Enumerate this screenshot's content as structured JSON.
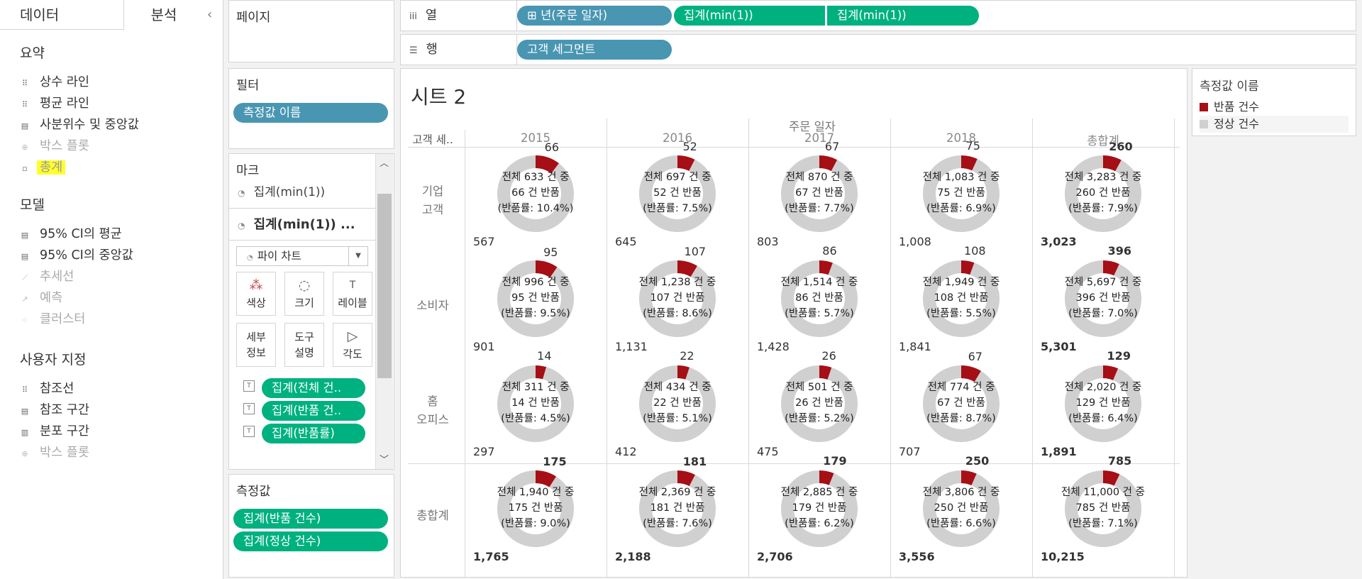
{
  "left": {
    "tabs": [
      "데이터",
      "분석"
    ],
    "collapse_glyph": "‹",
    "sections": [
      {
        "title": "요약",
        "items": [
          {
            "label": "상수 라인",
            "icon": "constant-line-icon",
            "glyph": "⠿",
            "enabled": true
          },
          {
            "label": "평균 라인",
            "icon": "average-line-icon",
            "glyph": "⠿",
            "enabled": true
          },
          {
            "label": "사분위수 및 중앙값",
            "icon": "quartile-icon",
            "glyph": "▤",
            "enabled": true
          },
          {
            "label": "박스 플롯",
            "icon": "box-plot-icon",
            "glyph": "⊕",
            "enabled": false
          },
          {
            "label": "총계",
            "icon": "totals-icon",
            "glyph": "▫",
            "enabled": true,
            "highlighted": true
          }
        ]
      },
      {
        "title": "모델",
        "items": [
          {
            "label": "95% CI의 평균",
            "icon": "ci-average-icon",
            "glyph": "▤",
            "enabled": true
          },
          {
            "label": "95% CI의 중앙값",
            "icon": "ci-median-icon",
            "glyph": "▤",
            "enabled": true
          },
          {
            "label": "추세선",
            "icon": "trend-line-icon",
            "glyph": "⟋",
            "enabled": false
          },
          {
            "label": "예측",
            "icon": "forecast-icon",
            "glyph": "↗",
            "enabled": false
          },
          {
            "label": "클러스터",
            "icon": "cluster-icon",
            "glyph": "⁘",
            "enabled": false
          }
        ]
      },
      {
        "title": "사용자 지정",
        "items": [
          {
            "label": "참조선",
            "icon": "reference-line-icon",
            "glyph": "⠿",
            "enabled": true
          },
          {
            "label": "참조 구간",
            "icon": "reference-band-icon",
            "glyph": "▤",
            "enabled": true
          },
          {
            "label": "분포 구간",
            "icon": "distribution-band-icon",
            "glyph": "▥",
            "enabled": true
          },
          {
            "label": "박스 플롯",
            "icon": "box-plot-icon",
            "glyph": "⊕",
            "enabled": false
          }
        ]
      }
    ]
  },
  "pages": {
    "title": "페이지"
  },
  "filters": {
    "title": "필터",
    "pills": [
      "측정값 이름"
    ]
  },
  "marks": {
    "title": "마크",
    "cards": [
      {
        "label": "집계(min(1))",
        "selected": false
      },
      {
        "label": "집계(min(1)) ...",
        "selected": true
      }
    ],
    "mark_type": "파이 차트",
    "buttons": [
      {
        "label": "색상",
        "icon": "color-icon",
        "glyph": "⁂"
      },
      {
        "label": "크기",
        "icon": "size-icon",
        "glyph": "◌"
      },
      {
        "label": "레이블",
        "icon": "label-icon",
        "glyph": "T"
      },
      {
        "label": "세부\n정보",
        "icon": "detail-icon",
        "glyph": ""
      },
      {
        "label": "도구\n설명",
        "icon": "tooltip-icon",
        "glyph": ""
      },
      {
        "label": "각도",
        "icon": "angle-icon",
        "glyph": "▷"
      }
    ],
    "fields": [
      "집계(전체 건..",
      "집계(반품 건..",
      "집계(반품률)"
    ]
  },
  "measure_values": {
    "title": "측정값",
    "pills": [
      "집계(반품 건수)",
      "집계(정상 건수)"
    ]
  },
  "columns": {
    "label": "열",
    "icon": "iii",
    "pills": [
      "⊞ 년(주문 일자)",
      "집계(min(1))",
      "집계(min(1))"
    ]
  },
  "rows": {
    "label": "행",
    "icon": "☰",
    "pills": [
      "고객 세그먼트"
    ]
  },
  "sheet": {
    "title": "시트 2",
    "col_group_header": "주문 일자",
    "row_header": "고객 세.."
  },
  "legend": {
    "title": "측정값 이름",
    "items": [
      {
        "label": "반품 건수",
        "color": "#a50f15"
      },
      {
        "label": "정상 건수",
        "color": "#d0d0d0"
      }
    ]
  },
  "colors": {
    "returns": "#a50f15",
    "normal": "#d0d0d0",
    "pill_blue": "#4996b2",
    "pill_green": "#00b180"
  },
  "chart_data": {
    "type": "pie",
    "columns": [
      "2015",
      "2016",
      "2017",
      "2018",
      "총합계"
    ],
    "rows": [
      "기업\n고객",
      "소비자",
      "홈\n오피스",
      "총합계"
    ],
    "series": [
      {
        "name": "반품 건수"
      },
      {
        "name": "정상 건수"
      }
    ],
    "cells": [
      [
        {
          "total": "633",
          "returns": 66,
          "normal": 567,
          "normal_label": "567",
          "rate": "10.4%"
        },
        {
          "total": "697",
          "returns": 52,
          "normal": 645,
          "normal_label": "645",
          "rate": "7.5%"
        },
        {
          "total": "870",
          "returns": 67,
          "normal": 803,
          "normal_label": "803",
          "rate": "7.7%"
        },
        {
          "total": "1,083",
          "returns": 75,
          "normal": 1008,
          "normal_label": "1,008",
          "rate": "6.9%"
        },
        {
          "total": "3,283",
          "returns": 260,
          "normal": 3023,
          "normal_label": "3,023",
          "rate": "7.9%"
        }
      ],
      [
        {
          "total": "996",
          "returns": 95,
          "normal": 901,
          "normal_label": "901",
          "rate": "9.5%"
        },
        {
          "total": "1,238",
          "returns": 107,
          "normal": 1131,
          "normal_label": "1,131",
          "rate": "8.6%"
        },
        {
          "total": "1,514",
          "returns": 86,
          "normal": 1428,
          "normal_label": "1,428",
          "rate": "5.7%"
        },
        {
          "total": "1,949",
          "returns": 108,
          "normal": 1841,
          "normal_label": "1,841",
          "rate": "5.5%"
        },
        {
          "total": "5,697",
          "returns": 396,
          "normal": 5301,
          "normal_label": "5,301",
          "rate": "7.0%"
        }
      ],
      [
        {
          "total": "311",
          "returns": 14,
          "normal": 297,
          "normal_label": "297",
          "rate": "4.5%"
        },
        {
          "total": "434",
          "returns": 22,
          "normal": 412,
          "normal_label": "412",
          "rate": "5.1%"
        },
        {
          "total": "501",
          "returns": 26,
          "normal": 475,
          "normal_label": "475",
          "rate": "5.2%"
        },
        {
          "total": "774",
          "returns": 67,
          "normal": 707,
          "normal_label": "707",
          "rate": "8.7%"
        },
        {
          "total": "2,020",
          "returns": 129,
          "normal": 1891,
          "normal_label": "1,891",
          "rate": "6.4%"
        }
      ],
      [
        {
          "total": "1,940",
          "returns": 175,
          "normal": 1765,
          "normal_label": "1,765",
          "rate": "9.0%"
        },
        {
          "total": "2,369",
          "returns": 181,
          "normal": 2188,
          "normal_label": "2,188",
          "rate": "7.6%"
        },
        {
          "total": "2,885",
          "returns": 179,
          "normal": 2706,
          "normal_label": "2,706",
          "rate": "6.2%"
        },
        {
          "total": "3,806",
          "returns": 250,
          "normal": 3556,
          "normal_label": "3,556",
          "rate": "6.6%"
        },
        {
          "total": "11,000",
          "returns": 785,
          "normal": 10215,
          "normal_label": "10,215",
          "rate": "7.1%"
        }
      ]
    ]
  }
}
